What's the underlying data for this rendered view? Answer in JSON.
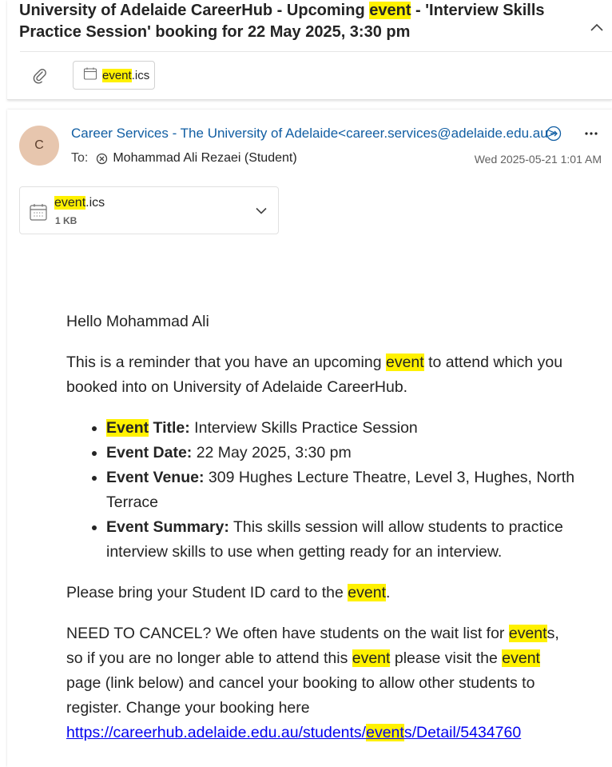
{
  "conversation": {
    "subject_before": "University of Adelaide CareerHub - Upcoming ",
    "subject_highlight": "event",
    "subject_after": " - 'Interview Skills Practice Session' booking for 22 May 2025, 3:30 pm",
    "chip": {
      "name_highlight": "event",
      "name_rest": ".ics"
    }
  },
  "message": {
    "avatar_initial": "C",
    "sender": "Career Services - The University of Adelaide<career.services@adelaide.edu.au>",
    "to_label": "To:",
    "recipient": "Mohammad Ali Rezaei (Student)",
    "timestamp": "Wed 2025-05-21 1:01 AM",
    "attachment": {
      "name_highlight": "event",
      "name_rest": ".ics",
      "size": "1 KB"
    }
  },
  "body": {
    "greeting": "Hello Mohammad Ali",
    "intro_before": "This is a reminder that you have an upcoming ",
    "intro_hl": "event",
    "intro_after": " to attend which you booked into on University of Adelaide CareerHub.",
    "details": {
      "title_hl": "Event",
      "title_label": " Title:",
      "title_value": " Interview Skills Practice Session",
      "date_label": "Event Date:",
      "date_value": " 22 May 2025, 3:30 pm",
      "venue_label": "Event Venue:",
      "venue_value": " 309 Hughes Lecture Theatre, Level 3, Hughes, North Terrace",
      "summary_label": "Event Summary:",
      "summary_value": " This skills session will allow students to practice interview skills to use when getting ready for an interview."
    },
    "bring_before": "Please bring your Student ID card to the ",
    "bring_hl": "event",
    "bring_after": ".",
    "cancel_1": "NEED TO CANCEL? We often have students on the wait list for ",
    "cancel_hl1": "event",
    "cancel_2": "s, so if you are no longer able to attend this ",
    "cancel_hl2": "event",
    "cancel_3": " please visit the ",
    "cancel_hl3": "event",
    "cancel_4": " page (link below) and cancel your booking to allow other students to register. Change your booking here",
    "link_before": "https://careerhub.adelaide.edu.au/students/",
    "link_hl": "event",
    "link_after": "s/Detail/5434760"
  },
  "colors": {
    "highlight": "#fff100",
    "sender_link": "#115ea3",
    "avatar_bg": "#e7c6ae"
  },
  "icons": [
    "collapse-chevron-up-icon",
    "paperclip-icon",
    "calendar-file-icon",
    "presence-icon",
    "more-options-icon",
    "blocked-user-icon",
    "chevron-down-icon"
  ]
}
